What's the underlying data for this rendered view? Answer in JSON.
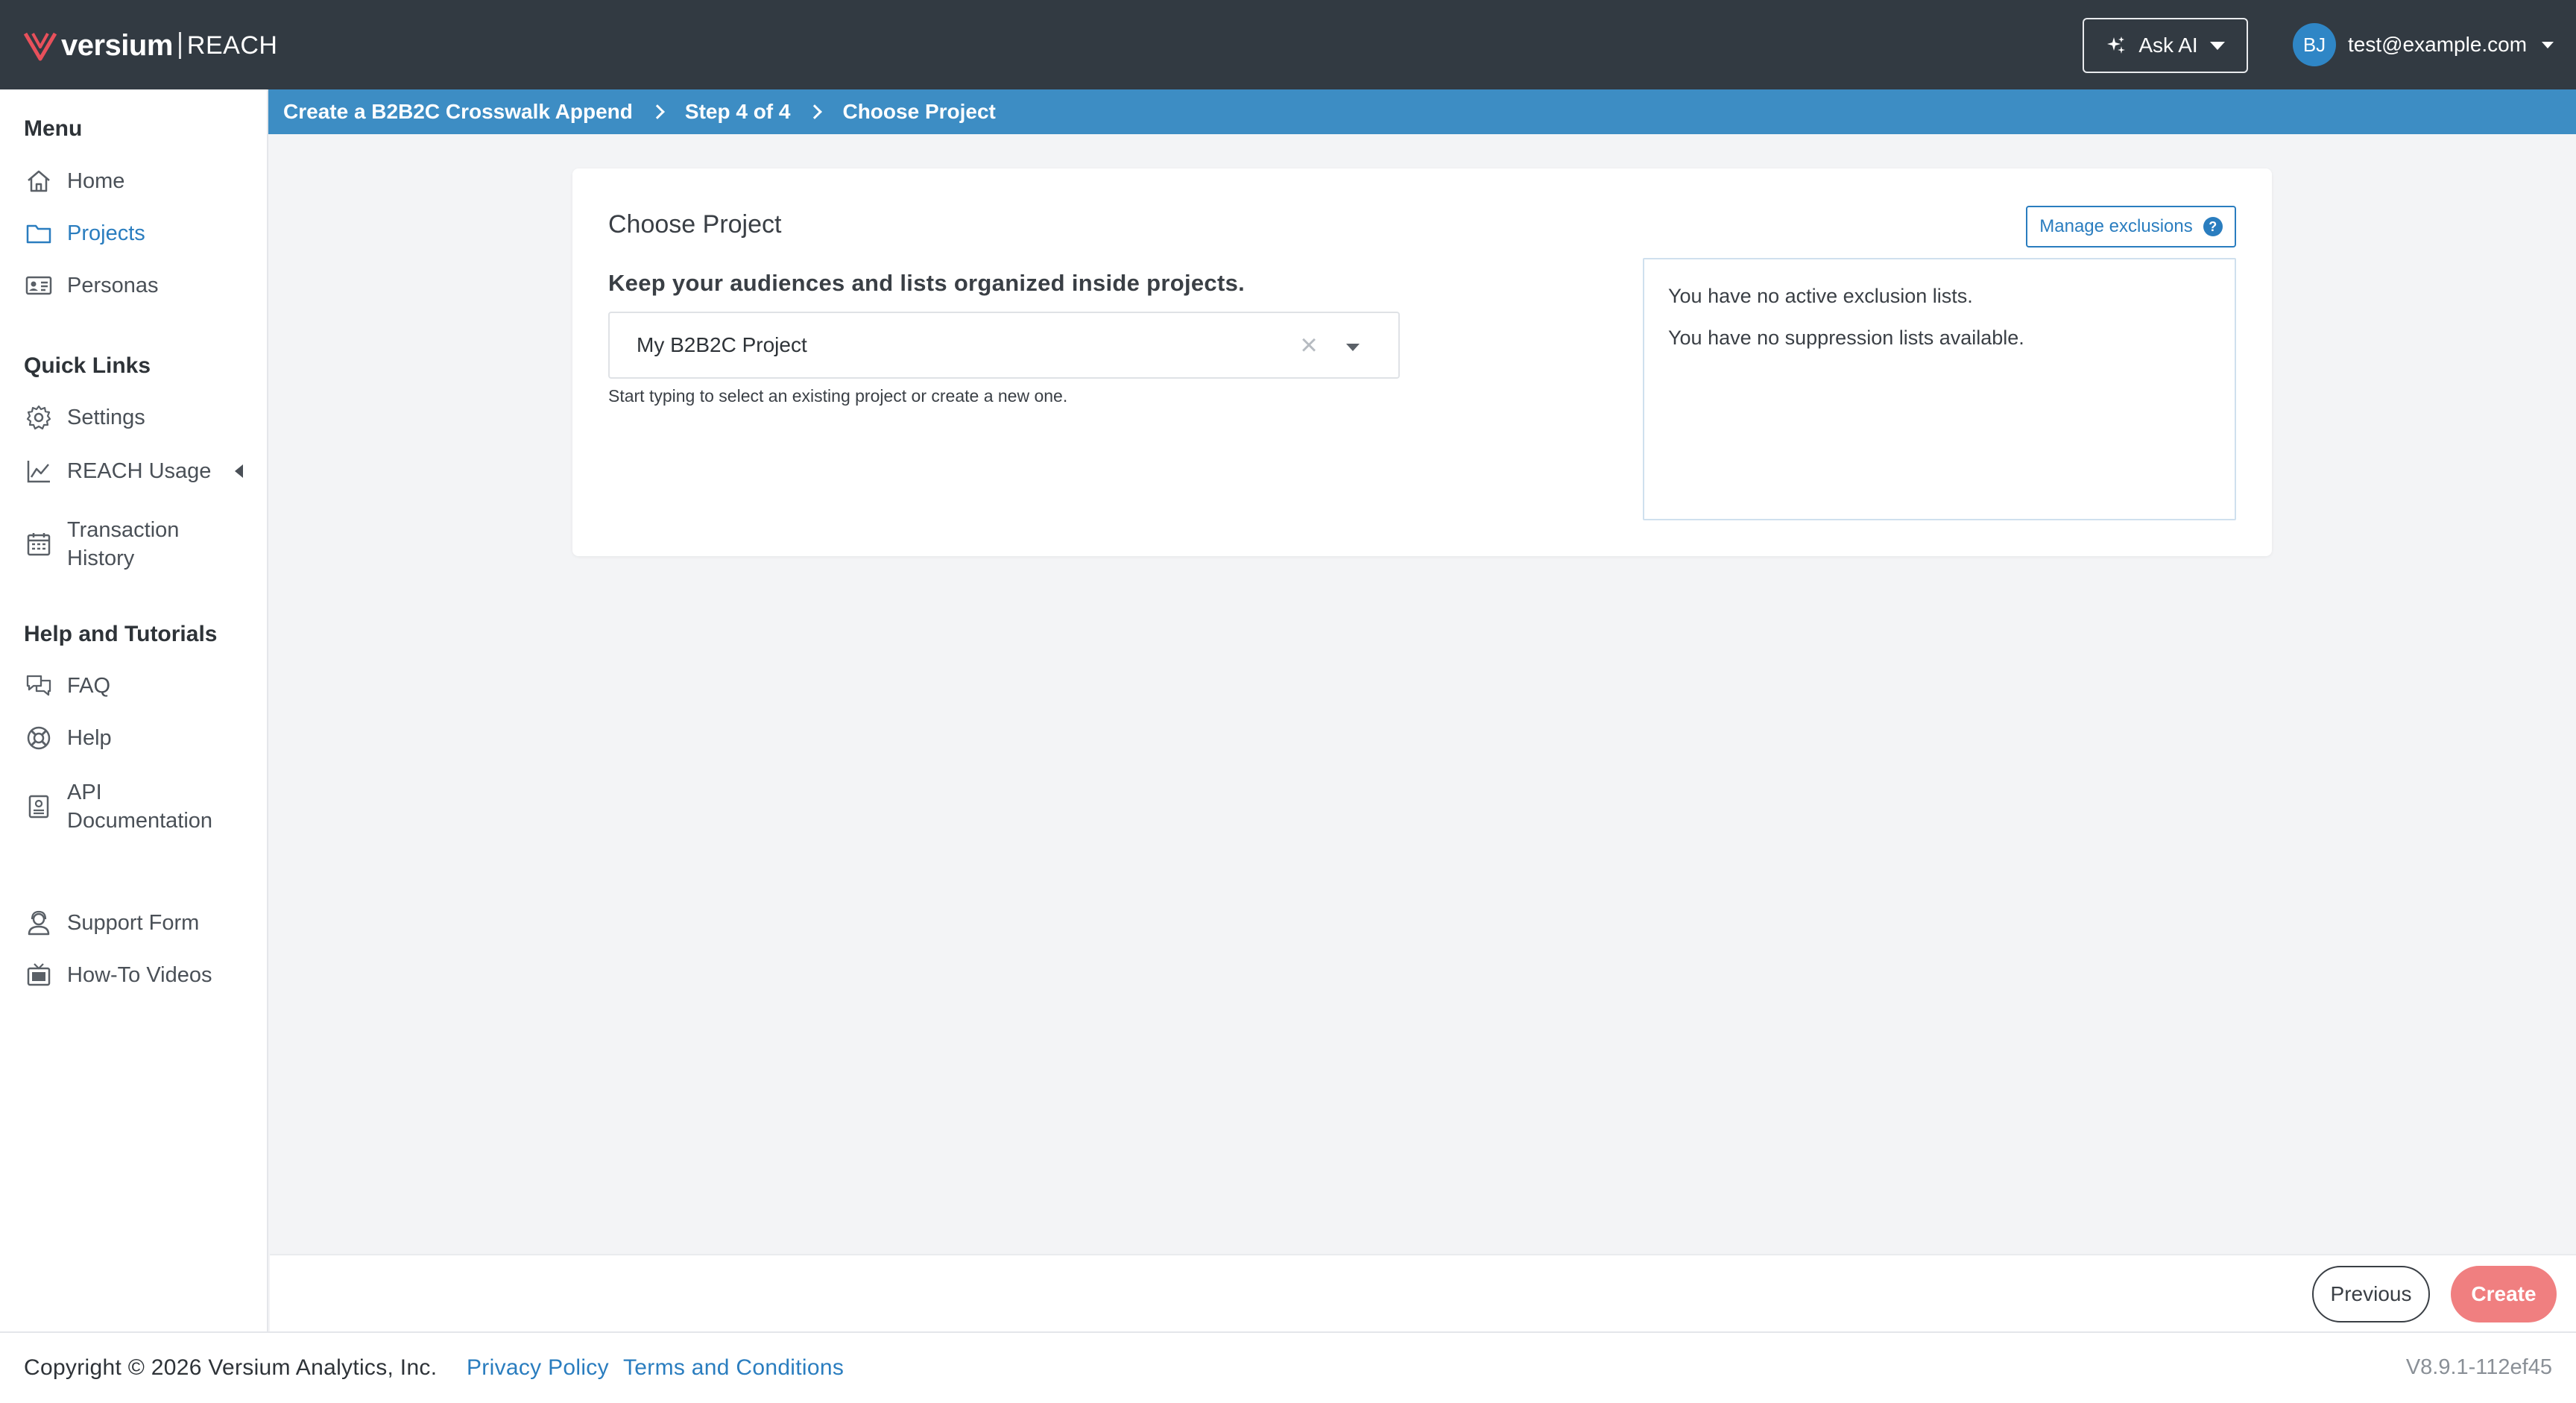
{
  "header": {
    "logo_word": "versium",
    "logo_product": "REACH",
    "ask_ai_label": "Ask AI",
    "user_initials": "BJ",
    "user_email": "test@example.com"
  },
  "sidebar": {
    "menu_heading": "Menu",
    "menu_items": [
      {
        "label": "Home",
        "icon": "home-icon"
      },
      {
        "label": "Projects",
        "icon": "folder-icon",
        "active": true
      },
      {
        "label": "Personas",
        "icon": "id-card-icon"
      }
    ],
    "quick_links_heading": "Quick Links",
    "quick_links": [
      {
        "label": "Settings",
        "icon": "gear-icon"
      },
      {
        "label": "REACH Usage",
        "icon": "chart-icon"
      },
      {
        "label_line1": "Transaction",
        "label_line2": "History",
        "icon": "calendar-icon"
      }
    ],
    "help_heading": "Help and Tutorials",
    "help_items": [
      {
        "label": "FAQ",
        "icon": "chat-bubbles-icon"
      },
      {
        "label": "Help",
        "icon": "lifebuoy-icon"
      },
      {
        "label_line1": "API",
        "label_line2": "Documentation",
        "icon": "document-icon"
      },
      {
        "label": "Support Form",
        "icon": "support-agent-icon"
      },
      {
        "label": "How-To Videos",
        "icon": "tv-icon"
      }
    ]
  },
  "breadcrumb": {
    "items": [
      "Create a B2B2C Crosswalk Append",
      "Step 4 of 4",
      "Choose Project"
    ]
  },
  "card": {
    "title": "Choose Project",
    "subtitle": "Keep your audiences and lists organized inside projects.",
    "project_value": "My B2B2C Project",
    "helper_text": "Start typing to select an existing project or create a new one.",
    "manage_label": "Manage exclusions",
    "exclusion_lines": [
      "You have no active exclusion lists.",
      "You have no suppression lists available."
    ]
  },
  "actions": {
    "previous_label": "Previous",
    "create_label": "Create"
  },
  "footer": {
    "copyright": "Copyright © 2026 Versium Analytics, Inc.",
    "privacy_label": "Privacy Policy",
    "terms_label": "Terms and Conditions",
    "version": "V8.9.1-112ef45"
  },
  "colors": {
    "topbar": "#323a42",
    "breadcrumb": "#3d8dc4",
    "accent": "#2a7dbf",
    "create_button": "#f07f80"
  }
}
